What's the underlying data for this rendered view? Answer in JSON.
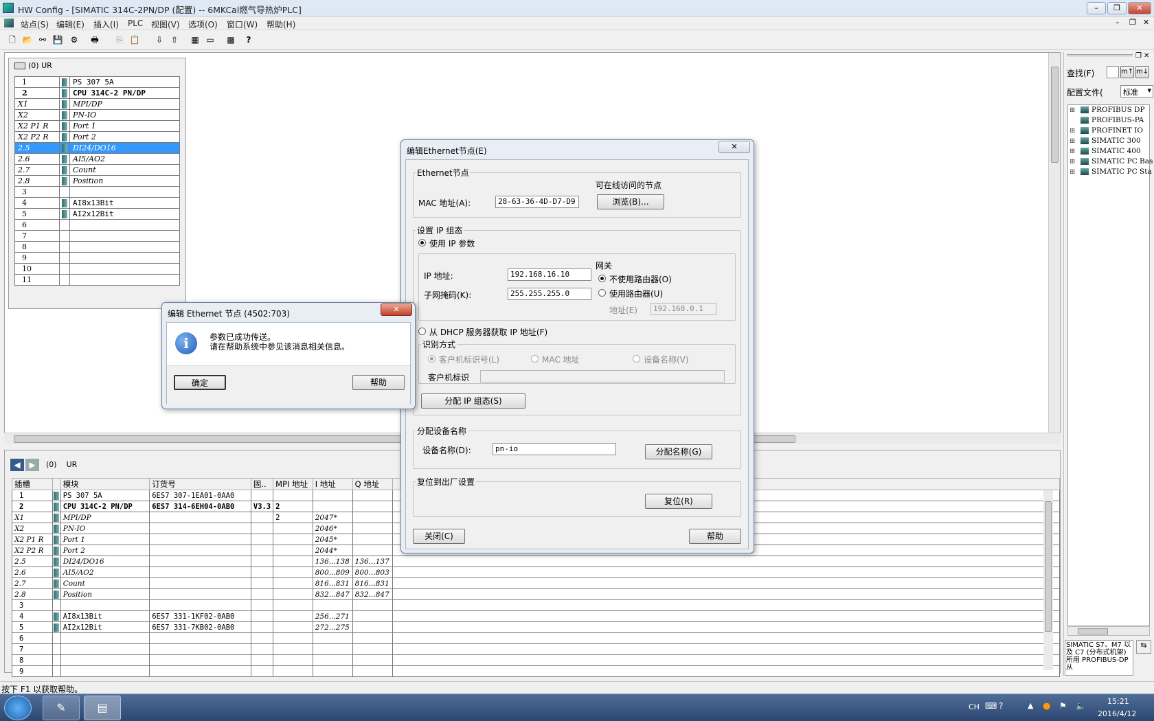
{
  "window": {
    "title": "HW Config - [SIMATIC 314C-2PN/DP (配置) -- 6MKCal燃气导热炉PLC]"
  },
  "menu": [
    "站点(S)",
    "编辑(E)",
    "插入(I)",
    "PLC",
    "视图(V)",
    "选项(O)",
    "窗口(W)",
    "帮助(H)"
  ],
  "rack": {
    "title": "(0)  UR",
    "rows": [
      {
        "slot": "1",
        "module": "PS 307 5A",
        "bold": false,
        "sel": false
      },
      {
        "slot": "2",
        "module": "CPU 314C-2 PN/DP",
        "bold": true,
        "sel": false
      },
      {
        "slot": "X1",
        "module": "MPI/DP",
        "bold": false,
        "sel": false
      },
      {
        "slot": "X2",
        "module": "PN-IO",
        "bold": false,
        "sel": false
      },
      {
        "slot": "X2 P1 R",
        "module": "Port 1",
        "bold": false,
        "sel": false
      },
      {
        "slot": "X2 P2 R",
        "module": "Port 2",
        "bold": false,
        "sel": false
      },
      {
        "slot": "2.5",
        "module": "DI24/DO16",
        "bold": false,
        "sel": true
      },
      {
        "slot": "2.6",
        "module": "AI5/AO2",
        "bold": false,
        "sel": false
      },
      {
        "slot": "2.7",
        "module": "Count",
        "bold": false,
        "sel": false
      },
      {
        "slot": "2.8",
        "module": "Position",
        "bold": false,
        "sel": false
      },
      {
        "slot": "3",
        "module": "",
        "bold": false,
        "sel": false
      },
      {
        "slot": "4",
        "module": "AI8x13Bit",
        "bold": false,
        "sel": false
      },
      {
        "slot": "5",
        "module": "AI2x12Bit",
        "bold": false,
        "sel": false
      },
      {
        "slot": "6",
        "module": "",
        "bold": false,
        "sel": false
      },
      {
        "slot": "7",
        "module": "",
        "bold": false,
        "sel": false
      },
      {
        "slot": "8",
        "module": "",
        "bold": false,
        "sel": false
      },
      {
        "slot": "9",
        "module": "",
        "bold": false,
        "sel": false
      },
      {
        "slot": "10",
        "module": "",
        "bold": false,
        "sel": false
      },
      {
        "slot": "11",
        "module": "",
        "bold": false,
        "sel": false
      }
    ]
  },
  "lower": {
    "nav": "(0)    UR",
    "headers": [
      "插槽",
      "模块",
      "订货号",
      "固..",
      "MPI 地址",
      "I 地址",
      "Q 地址"
    ],
    "rows": [
      [
        "1",
        "PS 307 5A",
        "6ES7 307-1EA01-0AA0",
        "",
        "",
        "",
        ""
      ],
      [
        "2",
        "CPU 314C-2 PN/DP",
        "6ES7 314-6EH04-0AB0",
        "V3.3",
        "2",
        "",
        ""
      ],
      [
        "X1",
        "MPI/DP",
        "",
        "",
        "2",
        "2047*",
        ""
      ],
      [
        "X2",
        "PN-IO",
        "",
        "",
        "",
        "2046*",
        ""
      ],
      [
        "X2 P1 R",
        "Port 1",
        "",
        "",
        "",
        "2045*",
        ""
      ],
      [
        "X2 P2 R",
        "Port 2",
        "",
        "",
        "",
        "2044*",
        ""
      ],
      [
        "2.5",
        "DI24/DO16",
        "",
        "",
        "",
        "136...138",
        "136...137"
      ],
      [
        "2.6",
        "AI5/AO2",
        "",
        "",
        "",
        "800...809",
        "800...803"
      ],
      [
        "2.7",
        "Count",
        "",
        "",
        "",
        "816...831",
        "816...831"
      ],
      [
        "2.8",
        "Position",
        "",
        "",
        "",
        "832...847",
        "832...847"
      ],
      [
        "3",
        "",
        "",
        "",
        "",
        "",
        ""
      ],
      [
        "4",
        "AI8x13Bit",
        "6ES7 331-1KF02-0AB0",
        "",
        "",
        "256...271",
        ""
      ],
      [
        "5",
        "AI2x12Bit",
        "6ES7 331-7KB02-0AB0",
        "",
        "",
        "272...275",
        ""
      ],
      [
        "6",
        "",
        "",
        "",
        "",
        "",
        ""
      ],
      [
        "7",
        "",
        "",
        "",
        "",
        "",
        ""
      ],
      [
        "8",
        "",
        "",
        "",
        "",
        "",
        ""
      ],
      [
        "9",
        "",
        "",
        "",
        "",
        "",
        ""
      ]
    ]
  },
  "catalog": {
    "find_label": "查找(F)",
    "profile_label": "配置文件(",
    "profile_value": "标准",
    "items": [
      "PROFIBUS DP",
      "PROFIBUS-PA",
      "PROFINET IO",
      "SIMATIC 300",
      "SIMATIC 400",
      "SIMATIC PC Bas",
      "SIMATIC PC Sta"
    ],
    "desc": "SIMATIC S7、M7 以及 C7 (分布式机架)所用 PROFIBUS-DP 从"
  },
  "eth": {
    "title": "编辑Ethernet节点(E)",
    "g1": "Ethernet节点",
    "online_label": "可在线访问的节点",
    "mac_label": "MAC 地址(A):",
    "mac": "28-63-36-4D-D7-D9",
    "browse": "浏览(B)...",
    "g2": "设置 IP 组态",
    "use_ip": "使用 IP 参数",
    "ip_label": "IP 地址:",
    "ip": "192.168.16.10",
    "mask_label": "子网掩码(K):",
    "mask": "255.255.255.0",
    "gw": "网关",
    "no_router": "不使用路由器(O)",
    "use_router": "使用路由器(U)",
    "addr_label": "地址(E)",
    "addr": "192.168.0.1",
    "dhcp": "从 DHCP 服务器获取 IP 地址(F)",
    "ident": "识别方式",
    "client_id": "客户机标识号(L)",
    "mac_opt": "MAC 地址",
    "dev_opt": "设备名称(V)",
    "client_label": "客户机标识",
    "assign_ip": "分配 IP 组态(S)",
    "g3": "分配设备名称",
    "devname_label": "设备名称(D):",
    "devname": "pn-io",
    "assign_name": "分配名称(G)",
    "g4": "复位到出厂设置",
    "reset": "复位(R)",
    "close": "关闭(C)",
    "help": "帮助"
  },
  "msg": {
    "title": "编辑 Ethernet 节点 (4502:703)",
    "line1": "参数已成功传送。",
    "line2": "请在帮助系统中参见该消息相关信息。",
    "ok": "确定",
    "help": "帮助"
  },
  "status": "按下 F1 以获取帮助。",
  "tray": {
    "lang": "CH",
    "time": "15:21",
    "date": "2016/4/12"
  }
}
